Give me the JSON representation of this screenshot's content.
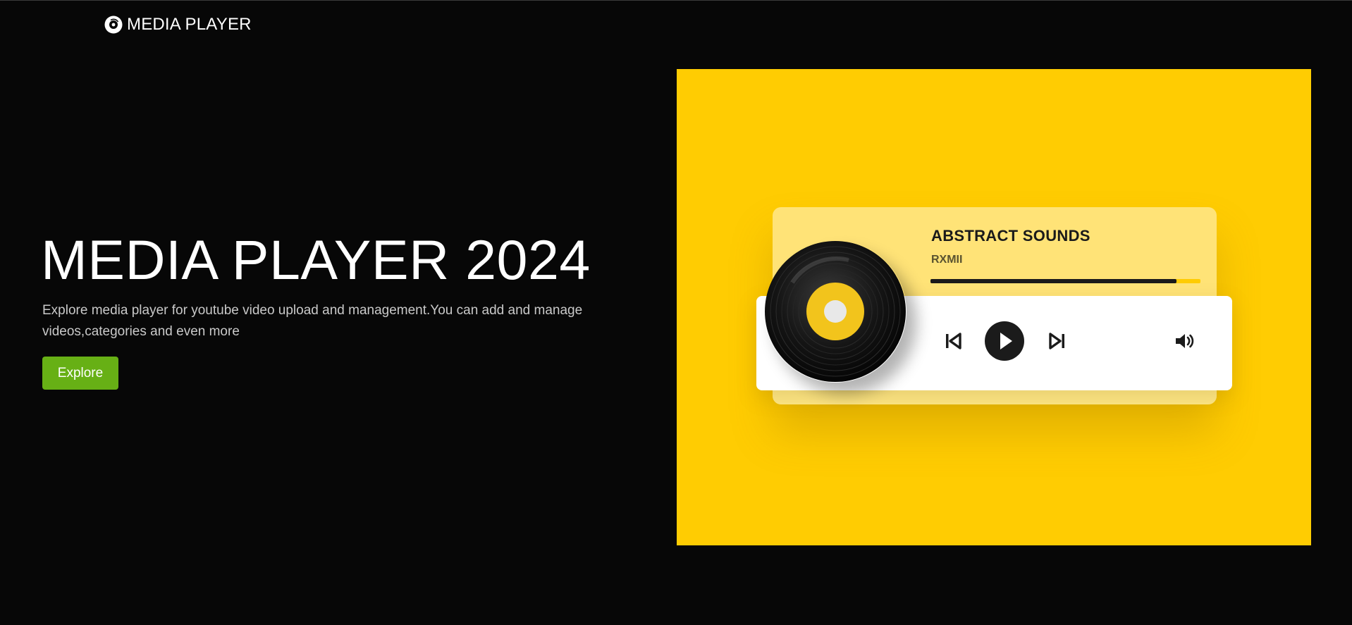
{
  "navbar": {
    "brand_icon": "vinyl-disc-icon",
    "brand_text": "MEDIA PLAYER"
  },
  "hero": {
    "title": "MEDIA PLAYER 2024",
    "description": "Explore media player for youtube video upload and management.You can add and manage videos,categories and even more",
    "button_label": "Explore"
  },
  "player_illustration": {
    "song_title": "ABSTRACT SOUNDS",
    "artist": "RXMII",
    "progress": 0.91,
    "icons": [
      "previous-track-icon",
      "play-icon",
      "next-track-icon",
      "volume-icon"
    ]
  },
  "colors": {
    "background": "#070707",
    "accent_green": "#67b015",
    "illustration_yellow": "#ffcc02"
  }
}
